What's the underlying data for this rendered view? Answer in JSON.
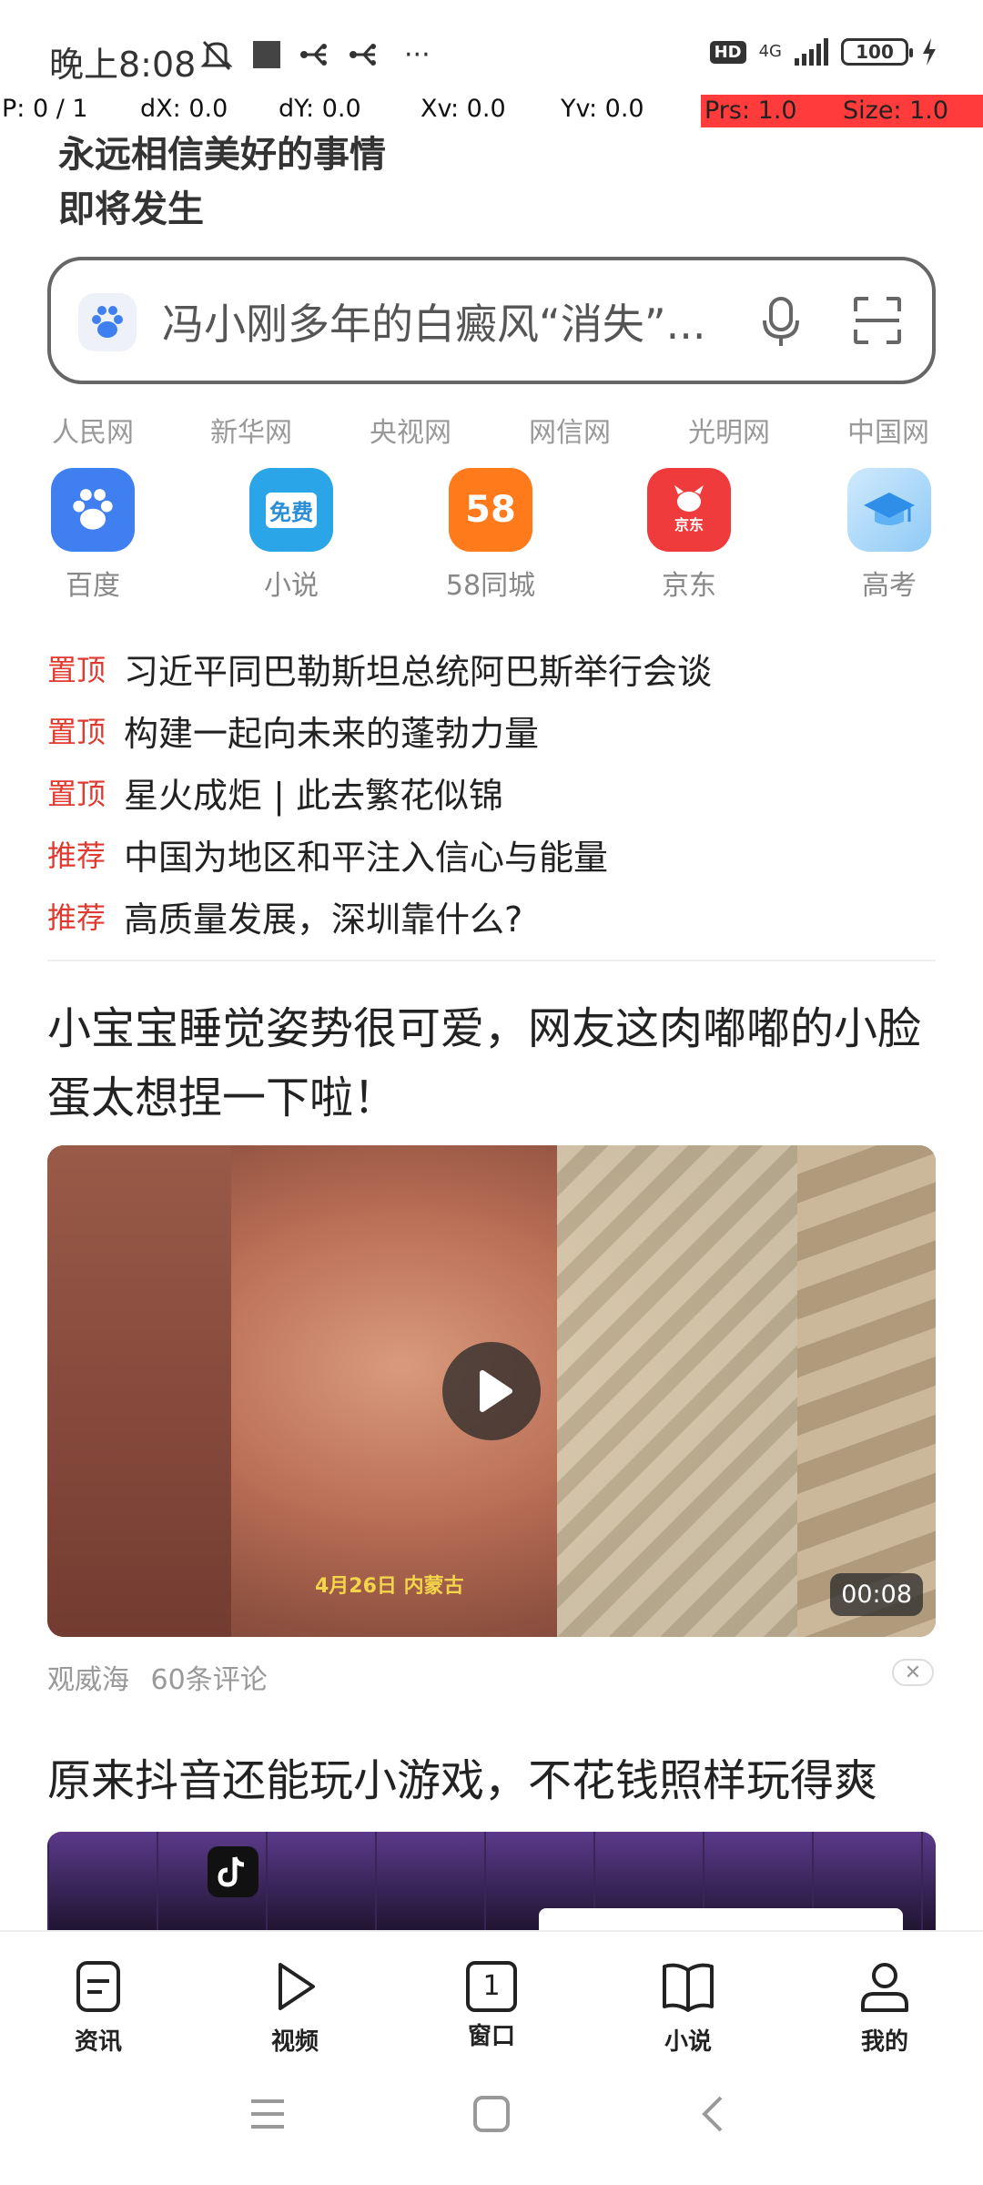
{
  "status_bar": {
    "time": "晚上8:08",
    "network": "4G",
    "hd_badge": "HD",
    "battery": "100",
    "more": "···"
  },
  "debug_overlay": {
    "p": "P: 0 / 1",
    "dx": "dX: 0.0",
    "dy": "dY: 0.0",
    "xv": "Xv: 0.0",
    "yv": "Yv: 0.0",
    "prs": "Prs: 1.0",
    "size": "Size: 1.0",
    "highlight_color": "#ff3b3b"
  },
  "slogan": {
    "line1": "永远相信美好的事情",
    "line2": "即将发生"
  },
  "search": {
    "query": "冯小刚多年的白癜风“消失”..."
  },
  "sources": [
    "人民网",
    "新华网",
    "央视网",
    "网信网",
    "光明网",
    "中国网"
  ],
  "apps": [
    {
      "label": "百度",
      "color": "#3f7ff0"
    },
    {
      "label": "小说",
      "color": "#2aa5e8",
      "badge": "免费"
    },
    {
      "label": "58同城",
      "color": "#ff7a1a",
      "badge": "58"
    },
    {
      "label": "京东",
      "color": "#ef3b3b",
      "badge": "京东"
    },
    {
      "label": "高考",
      "color": "#5fb3f5"
    }
  ],
  "headlines": [
    {
      "tag": "置顶",
      "text": "习近平同巴勒斯坦总统阿巴斯举行会谈"
    },
    {
      "tag": "置顶",
      "text": "构建一起向未来的蓬勃力量"
    },
    {
      "tag": "置顶",
      "text": "星火成炬 | 此去繁花似锦"
    },
    {
      "tag": "推荐",
      "text": "中国为地区和平注入信心与能量"
    },
    {
      "tag": "推荐",
      "text": "高质量发展，深圳靠什么?"
    }
  ],
  "feed": {
    "article1": {
      "title": "小宝宝睡觉姿势很可爱，网友这肉嘟嘟的小脸蛋太想捏一下啦！",
      "video_caption": "4月26日 内蒙古",
      "duration": "00:08",
      "source": "观威海",
      "comments": "60条评论"
    },
    "article2": {
      "title": "原来抖音还能玩小游戏，不花钱照样玩得爽"
    }
  },
  "bottom_nav": {
    "items": [
      {
        "label": "资讯"
      },
      {
        "label": "视频"
      },
      {
        "label": "窗口",
        "count": "1"
      },
      {
        "label": "小说"
      },
      {
        "label": "我的"
      }
    ]
  }
}
